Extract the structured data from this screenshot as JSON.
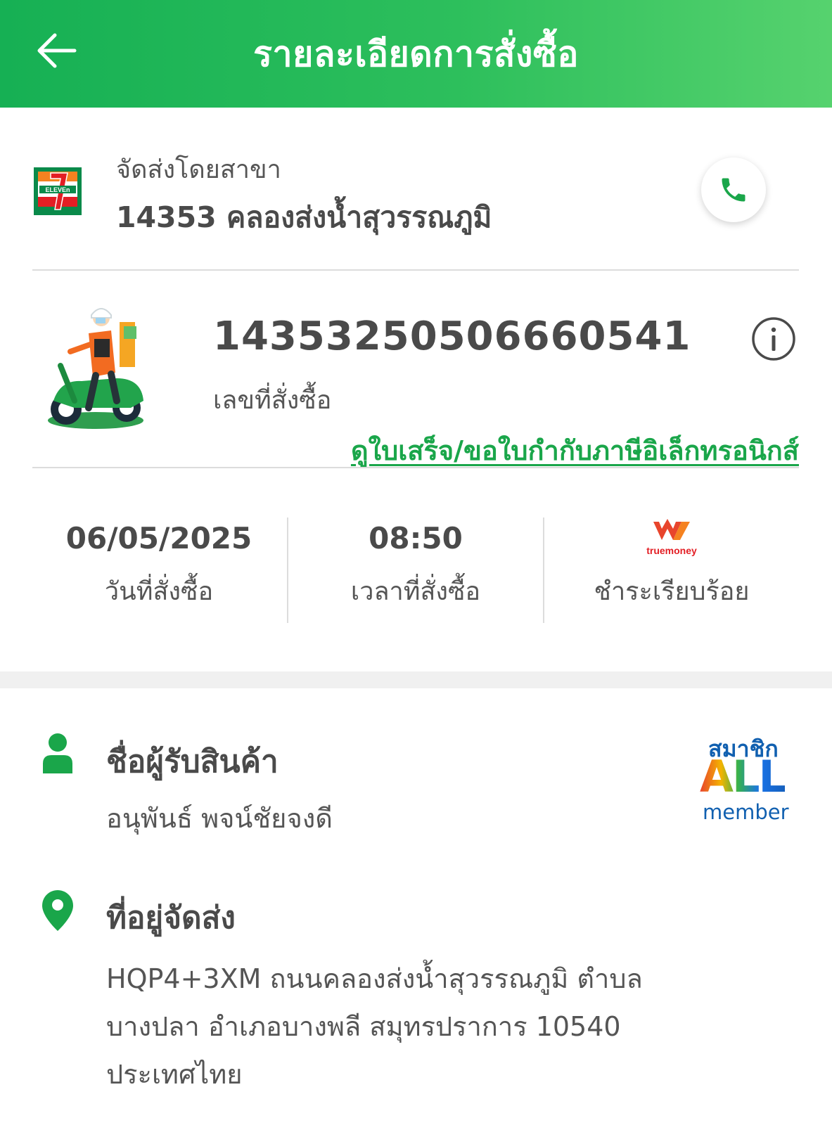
{
  "header": {
    "title": "รายละเอียดการสั่งซื้อ",
    "back_icon": "arrow-left-icon"
  },
  "store": {
    "delivered_by_label": "จัดส่งโดยสาขา",
    "name": "14353 คลองส่งน้ำสุวรรณภูมิ",
    "logo": "7-eleven-logo",
    "call_icon": "phone-icon"
  },
  "order": {
    "number": "14353250506660541",
    "number_label": "เลขที่สั่งซื้อ",
    "receipt_link": "ดูใบเสร็จ/ขอใบกำกับภาษีอิเล็กทรอนิกส์",
    "info_icon": "info-icon"
  },
  "stats": {
    "date": {
      "value": "06/05/2025",
      "label": "วันที่สั่งซื้อ"
    },
    "time": {
      "value": "08:50",
      "label": "เวลาที่สั่งซื้อ"
    },
    "payment": {
      "method_logo_text": "truemoney",
      "label": "ชำระเรียบร้อย"
    }
  },
  "recipient": {
    "title": "ชื่อผู้รับสินค้า",
    "name": "อนุพันธ์ พจน์ชัยจงดี",
    "member_badge": {
      "top": "สมาชิก",
      "middle": "ALL",
      "bottom": "member"
    }
  },
  "address": {
    "title": "ที่อยู่จัดส่ง",
    "line1": "HQP4+3XM ถนนคลองส่งน้ำสุวรรณภูมิ ตำบล",
    "line2": "บางปลา อำเภอบางพลี สมุทรปราการ 10540",
    "line3": "ประเทศไทย"
  },
  "colors": {
    "brand_green": "#1aa64a",
    "header_start": "#16b054",
    "header_end": "#56d26e"
  }
}
